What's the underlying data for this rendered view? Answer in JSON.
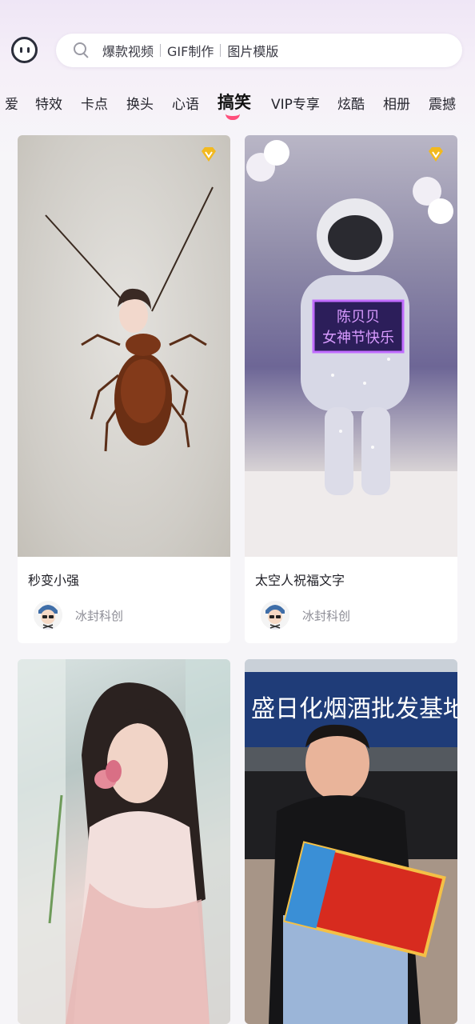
{
  "header": {
    "search_hints": [
      "爆款视频",
      "GIF制作",
      "图片模版"
    ]
  },
  "tabs": [
    "爱",
    "特效",
    "卡点",
    "换头",
    "心语",
    "搞笑",
    "VIP专享",
    "炫酷",
    "相册",
    "震撼"
  ],
  "active_tab": "搞笑",
  "cards": [
    {
      "title": "秒变小强",
      "author": "冰封科创",
      "vip": true,
      "icon": "cockroach-with-face-image"
    },
    {
      "title": "太空人祝福文字",
      "author": "冰封科创",
      "vip": true,
      "icon": "astronaut-image",
      "sign_text": [
        "陈贝贝",
        "女神节快乐"
      ]
    },
    {
      "title": "",
      "author": "",
      "vip": false,
      "icon": "girl-portrait-image"
    },
    {
      "title": "",
      "author": "",
      "vip": false,
      "icon": "man-with-box-image",
      "sign_text": "盛日化烟酒批发基地"
    }
  ],
  "colors": {
    "accent": "#ff4f7b",
    "vip_gold": "#f2b91f",
    "sign_purple": "#c06cff",
    "storefront_blue": "#1f3c78"
  }
}
